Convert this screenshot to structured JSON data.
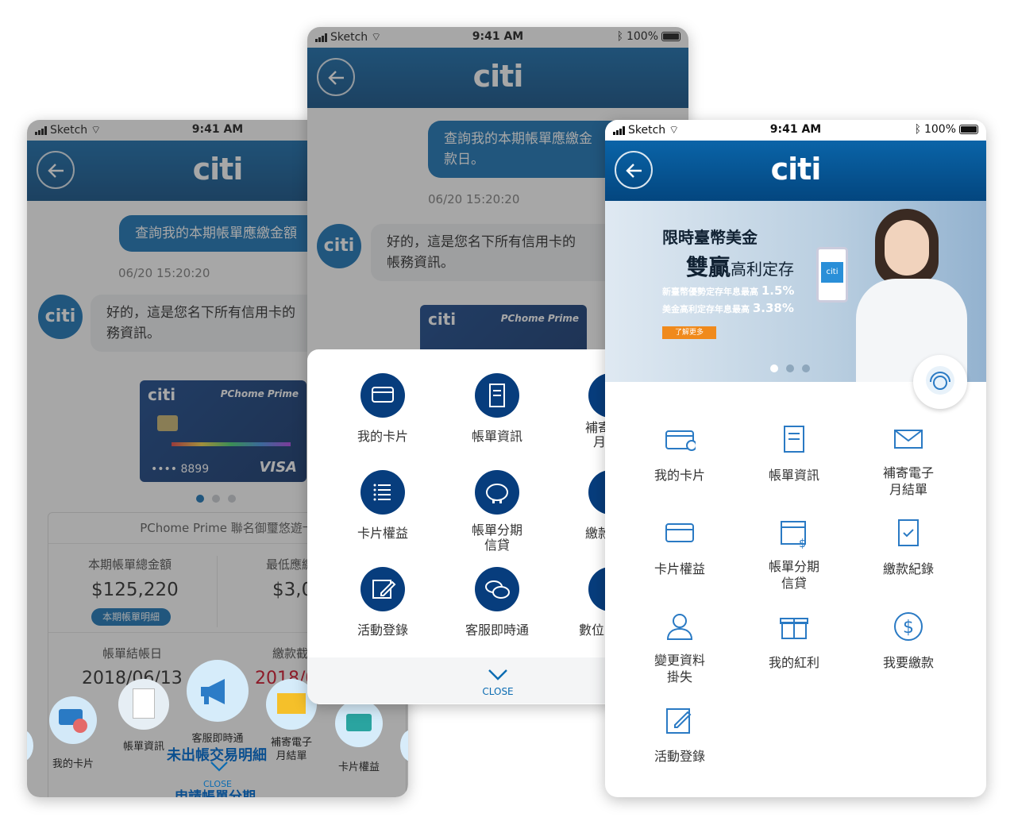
{
  "status": {
    "carrier": "Sketch",
    "time": "9:41 AM",
    "battery": "100%"
  },
  "brand": {
    "logo": "citi"
  },
  "chat": {
    "user_message_left": "查詢我的本期帳單應繳金額",
    "user_message_middle_line1": "查詢我的本期帳單應繳金",
    "user_message_middle_line2": "款日。",
    "timestamp": "06/20  15:20:20",
    "bot_reply_left_line1": "好的，這是您名下所有信用卡的",
    "bot_reply_left_line2": "務資訊。",
    "bot_reply_middle_line1": "好的，這是您名下所有信用卡的",
    "bot_reply_middle_line2": "帳務資訊。"
  },
  "card": {
    "brand": "PChome Prime",
    "number": "•••• 8899",
    "network": "VISA"
  },
  "bill": {
    "card_name": "PChome Prime 聯名御璽悠遊卡",
    "total_label": "本期帳單總金額",
    "total_value": "$125,220",
    "detail_button": "本期帳單明細",
    "min_label": "最低應繳",
    "min_value": "$3,0",
    "close_date_label": "帳單結帳日",
    "close_date_value": "2018/06/13",
    "due_label": "繳款截",
    "due_value": "2018/0",
    "unbilled_link": "未出帳交易明細",
    "installment_link": "申請帳單分期",
    "close_label": "CLOSE"
  },
  "carousel_menu": [
    "我的卡片",
    "帳單資訊",
    "客服即時通",
    "補寄電子月結單",
    "卡片權益"
  ],
  "middle_menu": {
    "items": [
      "我的卡片",
      "帳單資訊",
      "補寄電子月結單",
      "卡片權益",
      "帳單分期信貸",
      "繳款紀錄",
      "活動登錄",
      "客服即時通",
      "數位"
    ],
    "visible_labels": [
      "我的卡片",
      "帳單資訊",
      "補寄",
      "月",
      "卡片權益",
      "帳單分期",
      "信貸",
      "繳款",
      "活動登錄",
      "客服即時通",
      "數位"
    ],
    "close_label": "CLOSE"
  },
  "banner": {
    "line1": "限時臺幣美金",
    "line2_big": "雙贏",
    "line2_rest": "高利定存",
    "twd_rate_label": "新臺幣優勢定存年息最高",
    "twd_rate": "1.5%",
    "usd_rate_label": "美金高利定存年息最高",
    "usd_rate": "3.38%",
    "cta": "了解更多"
  },
  "right_menu": [
    {
      "line1": "我的卡片",
      "line2": ""
    },
    {
      "line1": "帳單資訊",
      "line2": ""
    },
    {
      "line1": "補寄電子",
      "line2": "月結單"
    },
    {
      "line1": "卡片權益",
      "line2": ""
    },
    {
      "line1": "帳單分期",
      "line2": "信貸"
    },
    {
      "line1": "繳款紀錄",
      "line2": ""
    },
    {
      "line1": "變更資料",
      "line2": "掛失"
    },
    {
      "line1": "我的紅利",
      "line2": ""
    },
    {
      "line1": "我要繳款",
      "line2": ""
    },
    {
      "line1": "活動登錄",
      "line2": ""
    }
  ]
}
